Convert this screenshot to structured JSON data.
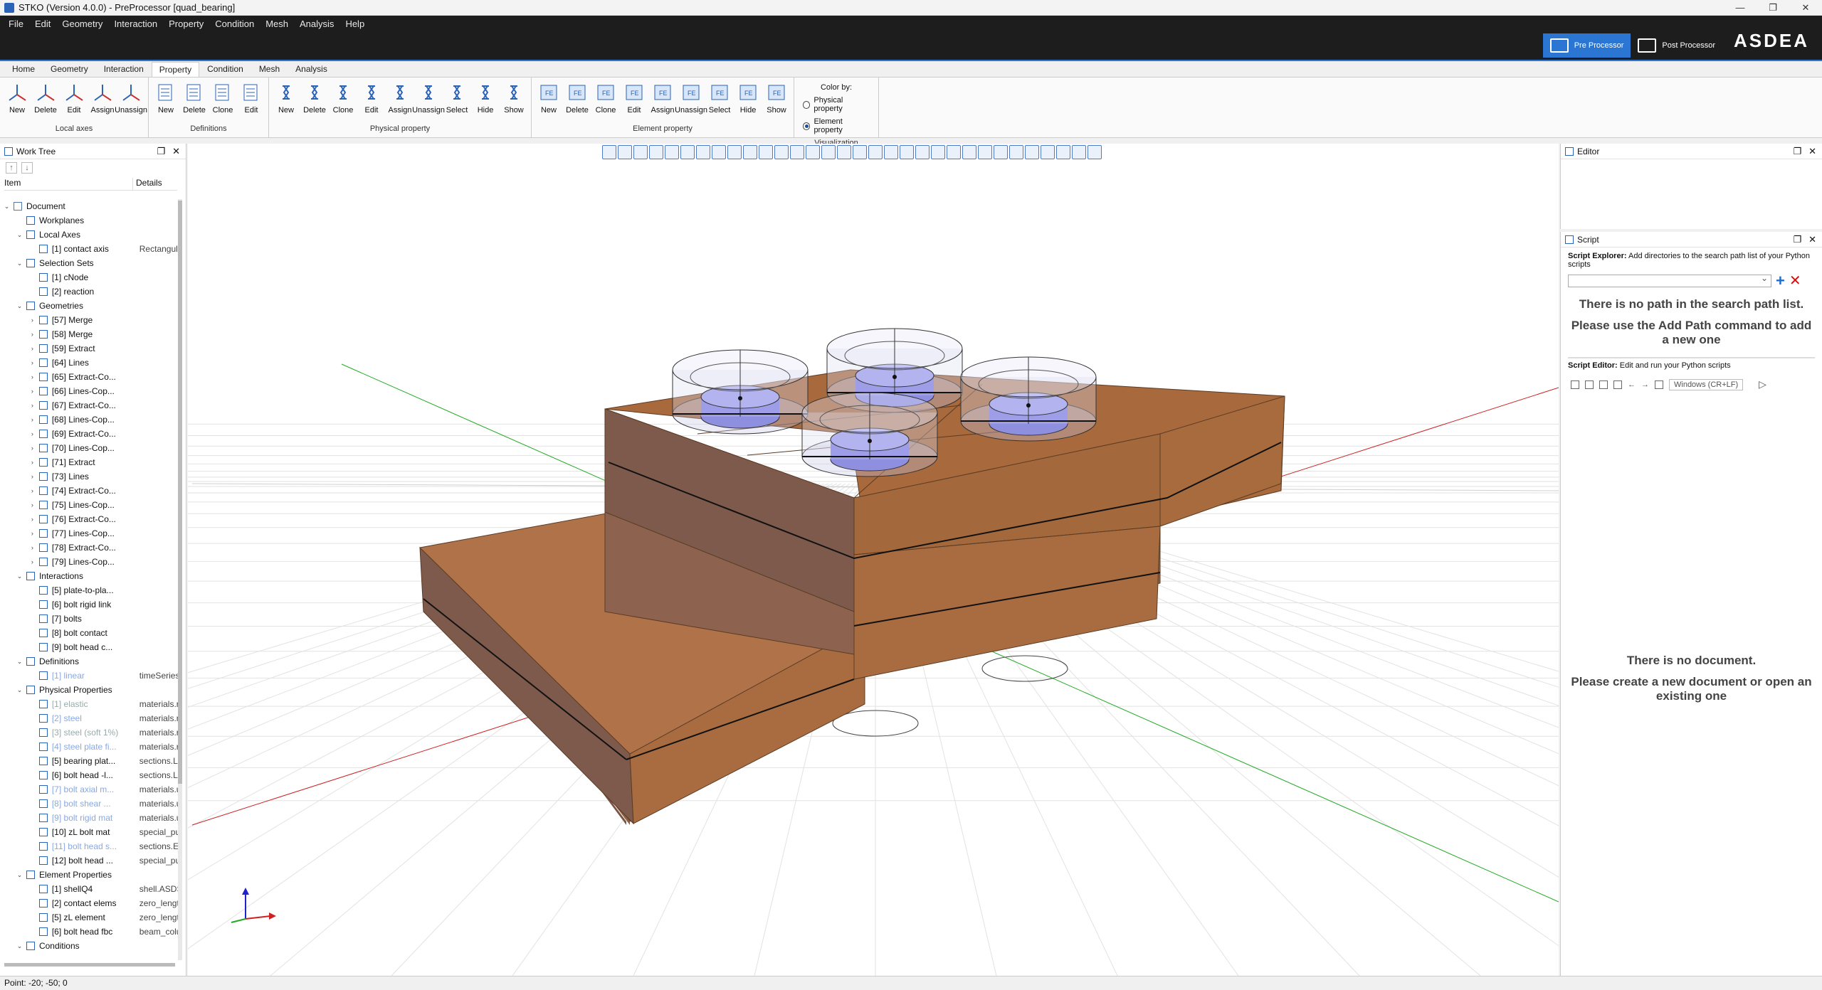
{
  "window": {
    "title": "STKO (Version 4.0.0) - PreProcessor [quad_bearing]"
  },
  "menu": [
    "File",
    "Edit",
    "Geometry",
    "Interaction",
    "Property",
    "Condition",
    "Mesh",
    "Analysis",
    "Help"
  ],
  "perspectives": {
    "pre": "Pre Processor",
    "post": "Post Processor"
  },
  "brand": "ASDEA",
  "ribbon_tabs": [
    "Home",
    "Geometry",
    "Interaction",
    "Property",
    "Condition",
    "Mesh",
    "Analysis"
  ],
  "ribbon_active": "Property",
  "ribbon_groups": [
    {
      "name": "Local axes",
      "buttons": [
        "New",
        "Delete",
        "Edit",
        "Assign",
        "Unassign"
      ]
    },
    {
      "name": "Definitions",
      "buttons": [
        "New",
        "Delete",
        "Clone",
        "Edit"
      ]
    },
    {
      "name": "Physical property",
      "buttons": [
        "New",
        "Delete",
        "Clone",
        "Edit",
        "Assign",
        "Unassign",
        "Select",
        "Hide",
        "Show"
      ]
    },
    {
      "name": "Element property",
      "buttons": [
        "New",
        "Delete",
        "Clone",
        "Edit",
        "Assign",
        "Unassign",
        "Select",
        "Hide",
        "Show"
      ]
    }
  ],
  "visualization": {
    "name": "Visualization",
    "color_by": "Color by:",
    "opt1": "Physical property",
    "opt2": "Element property",
    "selected": "Element property"
  },
  "worktree": {
    "title": "Work Tree",
    "col_item": "Item",
    "col_details": "Details",
    "rows": [
      {
        "level": 0,
        "arrow": "open",
        "name": "Document",
        "details": "",
        "style": "normal"
      },
      {
        "level": 1,
        "arrow": "none",
        "name": "Workplanes",
        "details": "",
        "style": "normal"
      },
      {
        "level": 1,
        "arrow": "open",
        "name": "Local Axes",
        "details": "",
        "style": "normal"
      },
      {
        "level": 2,
        "arrow": "none",
        "name": "[1] contact axis",
        "details": "Rectangula",
        "style": "normal"
      },
      {
        "level": 1,
        "arrow": "open",
        "name": "Selection Sets",
        "details": "",
        "style": "normal"
      },
      {
        "level": 2,
        "arrow": "none",
        "name": "[1] cNode",
        "details": "",
        "style": "normal"
      },
      {
        "level": 2,
        "arrow": "none",
        "name": "[2] reaction",
        "details": "",
        "style": "normal"
      },
      {
        "level": 1,
        "arrow": "open",
        "name": "Geometries",
        "details": "",
        "style": "normal"
      },
      {
        "level": 2,
        "arrow": "closed",
        "name": "[57] Merge",
        "details": "",
        "style": "normal"
      },
      {
        "level": 2,
        "arrow": "closed",
        "name": "[58] Merge",
        "details": "",
        "style": "normal"
      },
      {
        "level": 2,
        "arrow": "closed",
        "name": "[59] Extract",
        "details": "",
        "style": "normal"
      },
      {
        "level": 2,
        "arrow": "closed",
        "name": "[64] Lines",
        "details": "",
        "style": "normal"
      },
      {
        "level": 2,
        "arrow": "closed",
        "name": "[65] Extract-Co...",
        "details": "",
        "style": "normal"
      },
      {
        "level": 2,
        "arrow": "closed",
        "name": "[66] Lines-Cop...",
        "details": "",
        "style": "normal"
      },
      {
        "level": 2,
        "arrow": "closed",
        "name": "[67] Extract-Co...",
        "details": "",
        "style": "normal"
      },
      {
        "level": 2,
        "arrow": "closed",
        "name": "[68] Lines-Cop...",
        "details": "",
        "style": "normal"
      },
      {
        "level": 2,
        "arrow": "closed",
        "name": "[69] Extract-Co...",
        "details": "",
        "style": "normal"
      },
      {
        "level": 2,
        "arrow": "closed",
        "name": "[70] Lines-Cop...",
        "details": "",
        "style": "normal"
      },
      {
        "level": 2,
        "arrow": "closed",
        "name": "[71] Extract",
        "details": "",
        "style": "normal"
      },
      {
        "level": 2,
        "arrow": "closed",
        "name": "[73] Lines",
        "details": "",
        "style": "normal"
      },
      {
        "level": 2,
        "arrow": "closed",
        "name": "[74] Extract-Co...",
        "details": "",
        "style": "normal"
      },
      {
        "level": 2,
        "arrow": "closed",
        "name": "[75] Lines-Cop...",
        "details": "",
        "style": "normal"
      },
      {
        "level": 2,
        "arrow": "closed",
        "name": "[76] Extract-Co...",
        "details": "",
        "style": "normal"
      },
      {
        "level": 2,
        "arrow": "closed",
        "name": "[77] Lines-Cop...",
        "details": "",
        "style": "normal"
      },
      {
        "level": 2,
        "arrow": "closed",
        "name": "[78] Extract-Co...",
        "details": "",
        "style": "normal"
      },
      {
        "level": 2,
        "arrow": "closed",
        "name": "[79] Lines-Cop...",
        "details": "",
        "style": "normal"
      },
      {
        "level": 1,
        "arrow": "open",
        "name": "Interactions",
        "details": "",
        "style": "normal"
      },
      {
        "level": 2,
        "arrow": "none",
        "name": "[5] plate-to-pla...",
        "details": "",
        "style": "normal"
      },
      {
        "level": 2,
        "arrow": "none",
        "name": "[6] bolt rigid link",
        "details": "",
        "style": "normal"
      },
      {
        "level": 2,
        "arrow": "none",
        "name": "[7] bolts",
        "details": "",
        "style": "normal"
      },
      {
        "level": 2,
        "arrow": "none",
        "name": "[8] bolt contact",
        "details": "",
        "style": "normal"
      },
      {
        "level": 2,
        "arrow": "none",
        "name": "[9] bolt head c...",
        "details": "",
        "style": "normal"
      },
      {
        "level": 1,
        "arrow": "open",
        "name": "Definitions",
        "details": "",
        "style": "normal"
      },
      {
        "level": 2,
        "arrow": "none",
        "name": "[1] linear",
        "details": "timeSeries",
        "style": "dim"
      },
      {
        "level": 1,
        "arrow": "open",
        "name": "Physical Properties",
        "details": "",
        "style": "normal"
      },
      {
        "level": 2,
        "arrow": "none",
        "name": "[1] elastic",
        "details": "materials.r",
        "style": "grey"
      },
      {
        "level": 2,
        "arrow": "none",
        "name": "[2] steel",
        "details": "materials.r",
        "style": "dim"
      },
      {
        "level": 2,
        "arrow": "none",
        "name": "[3] steel (soft 1%)",
        "details": "materials.r",
        "style": "grey"
      },
      {
        "level": 2,
        "arrow": "none",
        "name": "[4] steel plate fi...",
        "details": "materials.r",
        "style": "dim"
      },
      {
        "level": 2,
        "arrow": "none",
        "name": "[5] bearing plat...",
        "details": "sections.La",
        "style": "normal"
      },
      {
        "level": 2,
        "arrow": "none",
        "name": "[6] bolt head -l...",
        "details": "sections.La",
        "style": "normal"
      },
      {
        "level": 2,
        "arrow": "none",
        "name": "[7] bolt axial m...",
        "details": "materials.u",
        "style": "dim"
      },
      {
        "level": 2,
        "arrow": "none",
        "name": "[8] bolt shear ...",
        "details": "materials.u",
        "style": "dim"
      },
      {
        "level": 2,
        "arrow": "none",
        "name": "[9] bolt rigid mat",
        "details": "materials.u",
        "style": "dim"
      },
      {
        "level": 2,
        "arrow": "none",
        "name": "[10] zL bolt mat",
        "details": "special_pu",
        "style": "normal"
      },
      {
        "level": 2,
        "arrow": "none",
        "name": "[11] bolt head s...",
        "details": "sections.El",
        "style": "dim"
      },
      {
        "level": 2,
        "arrow": "none",
        "name": "[12] bolt head ...",
        "details": "special_pu",
        "style": "normal"
      },
      {
        "level": 1,
        "arrow": "open",
        "name": "Element Properties",
        "details": "",
        "style": "normal"
      },
      {
        "level": 2,
        "arrow": "none",
        "name": "[1] shellQ4",
        "details": "shell.ASDS",
        "style": "normal"
      },
      {
        "level": 2,
        "arrow": "none",
        "name": "[2] contact elems",
        "details": "zero_lengt",
        "style": "normal"
      },
      {
        "level": 2,
        "arrow": "none",
        "name": "[5] zL element",
        "details": "zero_lengt",
        "style": "normal"
      },
      {
        "level": 2,
        "arrow": "none",
        "name": "[6] bolt head fbc",
        "details": "beam_colu",
        "style": "normal"
      },
      {
        "level": 1,
        "arrow": "open",
        "name": "Conditions",
        "details": "",
        "style": "normal"
      }
    ]
  },
  "editor": {
    "title": "Editor"
  },
  "script": {
    "title": "Script",
    "explorer_label": "Script Explorer:",
    "explorer_desc": "Add directories to the search path list of your Python scripts",
    "empty_line1": "There is no path in the search path list.",
    "empty_line2": "Please use the Add Path command to add a new one",
    "editor_label": "Script Editor:",
    "editor_desc": "Edit and run your Python scripts",
    "line_ending": "Windows (CR+LF)",
    "nodoc_line1": "There is no document.",
    "nodoc_line2": "Please create a new document or open an existing one"
  },
  "status": "Point: -20; -50; 0",
  "colors": {
    "accent": "#2a76d2",
    "plate": "#b0764a",
    "bolt": "#8f8fe0",
    "x_axis": "#cc2222",
    "y_axis": "#22aa22",
    "z_axis": "#2222cc"
  }
}
